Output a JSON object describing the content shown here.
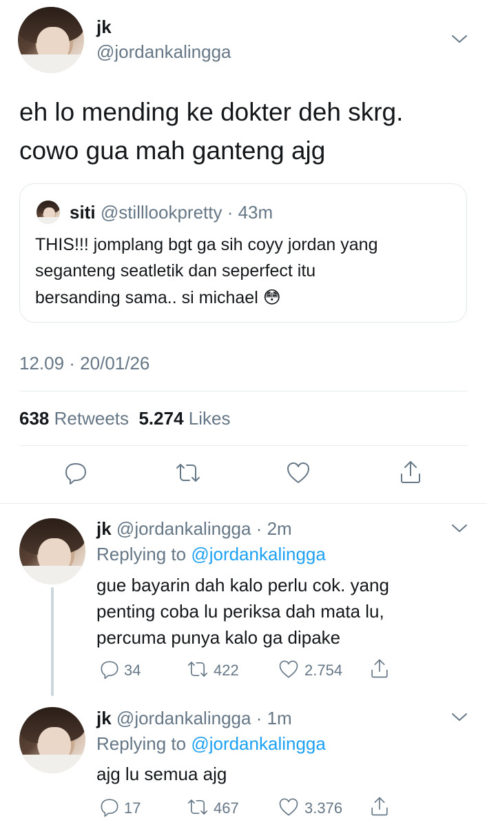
{
  "main_tweet": {
    "display_name": "jk",
    "handle": "@jordankalingga",
    "text_line1": "eh lo mending ke dokter deh skrg.",
    "text_line2": "cowo gua mah ganteng ajg",
    "quote": {
      "display_name": "siti",
      "handle": "@stilllookpretty",
      "time": "· 43m",
      "line1": "THIS!!! jomplang bgt ga sih coyy jordan yang",
      "line2": "seganteng seatletik dan seperfect itu",
      "line3": "bersanding sama.. si michael 😳"
    },
    "timestamp": "12.09 · 20/01/26",
    "retweet_count": "638",
    "retweet_label": "Retweets",
    "like_count": "5.274",
    "like_label": "Likes"
  },
  "replies": [
    {
      "display_name": "jk",
      "handle": "@jordankalingga",
      "time": "· 2m",
      "replying_label": "Replying to",
      "replying_handle": "@jordankalingga",
      "line1": "gue bayarin dah kalo perlu cok. yang",
      "line2": "penting coba lu periksa dah mata lu,",
      "line3": "percuma punya kalo ga dipake",
      "replies": "34",
      "retweets": "422",
      "likes": "2.754"
    },
    {
      "display_name": "jk",
      "handle": "@jordankalingga",
      "time": "· 1m",
      "replying_label": "Replying to",
      "replying_handle": "@jordankalingga",
      "line1": "ajg lu semua ajg",
      "replies": "17",
      "retweets": "467",
      "likes": "3.376"
    }
  ],
  "icons": {
    "more": "chevron-down-icon",
    "reply": "reply-icon",
    "retweet": "retweet-icon",
    "like": "heart-icon",
    "share": "share-icon"
  }
}
